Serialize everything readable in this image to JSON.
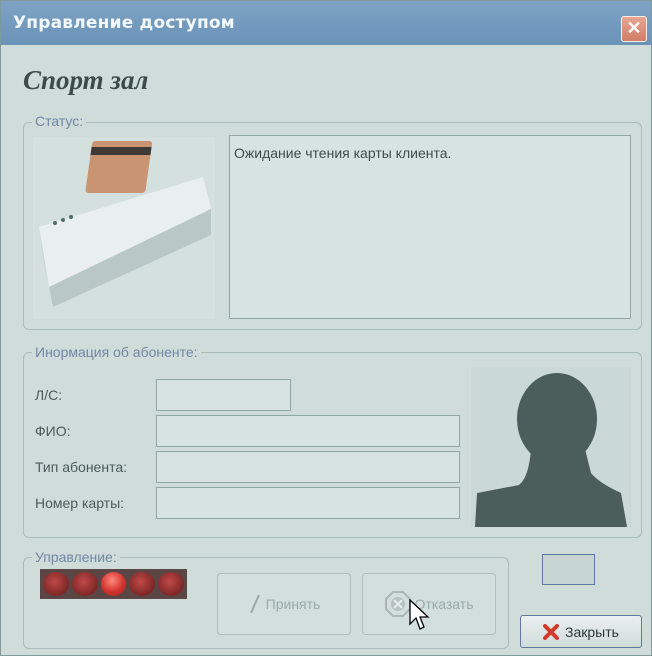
{
  "window": {
    "title": "Управление доступом"
  },
  "heading": "Спорт зал",
  "status_group": {
    "label": "Статус:",
    "message": "Ожидание чтения карты клиента."
  },
  "subscriber_group": {
    "label": "Инормация об абоненте:",
    "fields": [
      {
        "label": "Л/С:",
        "value": ""
      },
      {
        "label": "ФИО:",
        "value": ""
      },
      {
        "label": "Тип абонента:",
        "value": ""
      },
      {
        "label": "Номер карты:",
        "value": ""
      }
    ]
  },
  "control_group": {
    "label": "Управление:",
    "leds": {
      "count": 5,
      "lit_index": 2
    },
    "accept_label": "Принять",
    "reject_label": "Отказать"
  },
  "close_button": {
    "label": "Закрыть"
  },
  "icons": {
    "window_close": "close-icon",
    "accept": "slash-icon",
    "reject": "cross-circle-icon",
    "close": "red-x-icon",
    "reader": "card-reader-image",
    "photo": "silhouette-image"
  },
  "colors": {
    "titlebar": "#6f96ba",
    "led_on": "#e2403a",
    "led_off": "#8d2c2a"
  }
}
